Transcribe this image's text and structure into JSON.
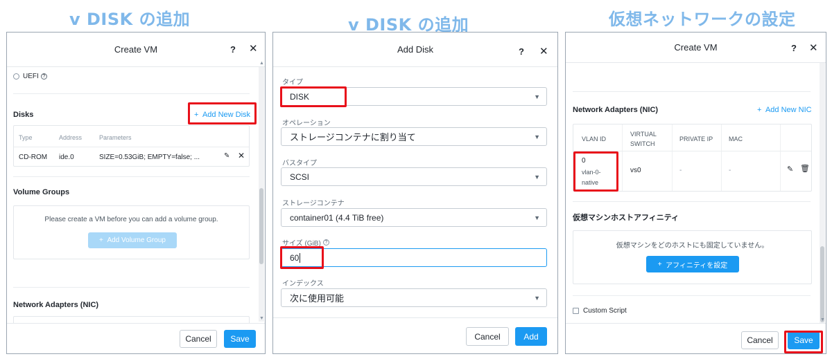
{
  "headings": {
    "left": "v DISK の追加",
    "middle": "v DISK の追加",
    "right": "仮想ネットワークの設定"
  },
  "panel1": {
    "title": "Create VM",
    "help": "?",
    "close": "✕",
    "uefi_label": "UEFI",
    "disks_title": "Disks",
    "add_disk": "Add New Disk",
    "table_headers": [
      "Type",
      "Address",
      "Parameters"
    ],
    "disk_row": {
      "type": "CD-ROM",
      "address": "ide.0",
      "parameters": "SIZE=0.53GiB; EMPTY=false; ..."
    },
    "vg_title": "Volume Groups",
    "vg_message": "Please create a VM before you can add a volume group.",
    "add_vg": "Add Volume Group",
    "nic_title": "Network Adapters (NIC)",
    "cancel": "Cancel",
    "save": "Save"
  },
  "panel2": {
    "title": "Add Disk",
    "help": "?",
    "close": "✕",
    "type_label": "タイプ",
    "type_value": "DISK",
    "operation_label": "オペレーション",
    "operation_value": "ストレージコンテナに割り当て",
    "bustype_label": "バスタイプ",
    "bustype_value": "SCSI",
    "container_label": "ストレージコンテナ",
    "container_value": "container01 (4.4 TiB free)",
    "size_label": "サイズ (GiB)",
    "size_value": "60",
    "index_label": "インデックス",
    "index_value": "次に使用可能",
    "cancel": "Cancel",
    "add": "Add"
  },
  "panel3": {
    "title": "Create VM",
    "help": "?",
    "close": "✕",
    "nic_title": "Network Adapters (NIC)",
    "add_nic": "Add New NIC",
    "table_headers": [
      "VLAN ID",
      "VIRTUAL SWITCH",
      "PRIVATE IP",
      "MAC"
    ],
    "nic_row": {
      "vlan_id": "0",
      "vlan_name": "vlan-0-native",
      "switch": "vs0",
      "private_ip": "-",
      "mac": "-"
    },
    "affinity_title": "仮想マシンホストアフィニティ",
    "affinity_message": "仮想マシンをどのホストにも固定していません。",
    "set_affinity": "アフィニティを設定",
    "custom_script": "Custom Script",
    "cancel": "Cancel",
    "save": "Save"
  },
  "colors": {
    "accent": "#1b9af2",
    "highlight": "#e8101a",
    "heading": "#7fb8ea"
  }
}
